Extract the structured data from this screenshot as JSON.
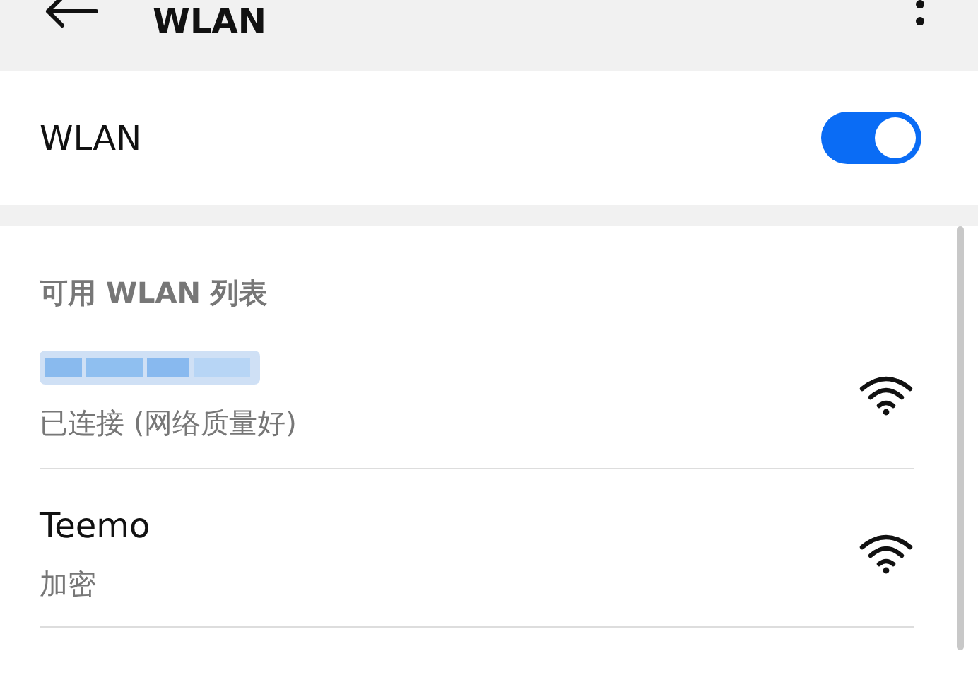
{
  "app_bar": {
    "title": "WLAN"
  },
  "wlan_toggle": {
    "label": "WLAN",
    "on": true
  },
  "list": {
    "heading": "可用 WLAN 列表",
    "networks": [
      {
        "kind": "redacted",
        "status": "已连接 (网络质量好)"
      },
      {
        "kind": "named",
        "name": "Teemo",
        "status": "加密"
      }
    ]
  }
}
